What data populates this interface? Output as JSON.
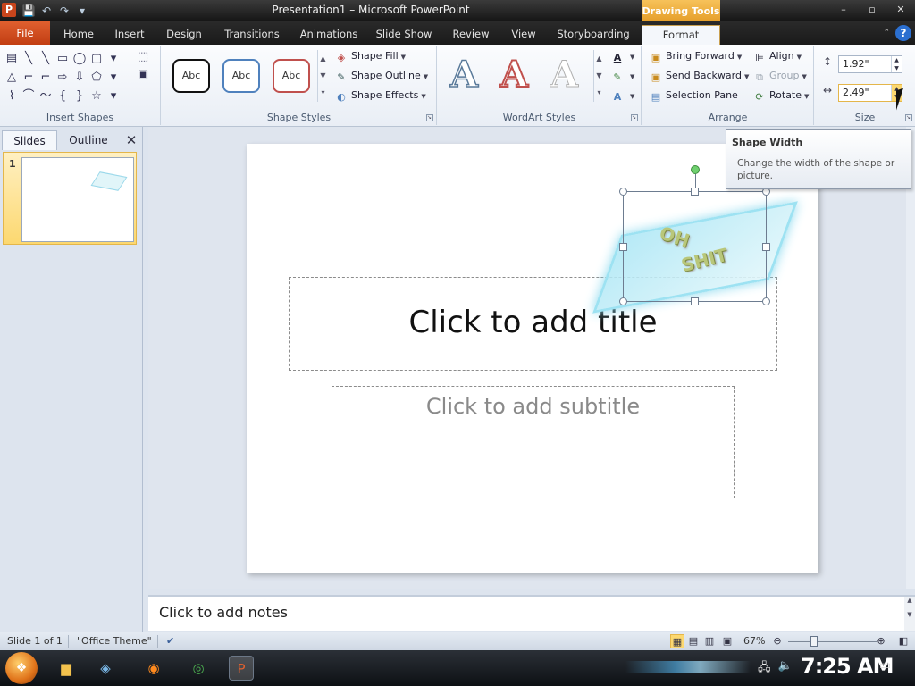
{
  "window": {
    "title": "Presentation1 – Microsoft PowerPoint",
    "app_icon": "P",
    "contextual_group": "Drawing Tools",
    "controls": [
      "–",
      "▫",
      "✕"
    ]
  },
  "qat": {
    "save_icon": "💾",
    "undo_icon": "↶",
    "redo_icon": "↷",
    "more_icon": "▾"
  },
  "tabs": [
    {
      "label": "File"
    },
    {
      "label": "Home"
    },
    {
      "label": "Insert"
    },
    {
      "label": "Design"
    },
    {
      "label": "Transitions"
    },
    {
      "label": "Animations"
    },
    {
      "label": "Slide Show"
    },
    {
      "label": "Review"
    },
    {
      "label": "View"
    },
    {
      "label": "Storyboarding"
    },
    {
      "label": "Format"
    }
  ],
  "ribbon": {
    "insert_shapes": {
      "label": "Insert Shapes",
      "shapes": [
        "▤",
        "╲",
        "╲",
        "▭",
        "◯",
        "▢",
        "▾",
        "△",
        "⌐",
        "⌐",
        "⇨",
        "⇩",
        "⬠",
        "▾",
        "⌇",
        "⌒",
        "〜",
        "{",
        "}",
        "☆",
        "▾"
      ],
      "edit_shape_icon": "⬚",
      "text_box_icon": "▣"
    },
    "shape_styles": {
      "label": "Shape Styles",
      "thumbs": [
        {
          "text": "Abc",
          "border": "#111111"
        },
        {
          "text": "Abc",
          "border": "#4f81bd"
        },
        {
          "text": "Abc",
          "border": "#c0504d"
        }
      ],
      "fill": "Shape Fill",
      "outline": "Shape Outline",
      "effects": "Shape Effects"
    },
    "wordart_styles": {
      "label": "WordArt Styles",
      "letters": [
        {
          "char": "A",
          "style": "outline-blue"
        },
        {
          "char": "A",
          "style": "outline-red"
        },
        {
          "char": "A",
          "style": "outline-gray"
        }
      ]
    },
    "arrange": {
      "label": "Arrange",
      "bring_forward": "Bring Forward",
      "send_backward": "Send Backward",
      "selection_pane": "Selection Pane",
      "align": "Align",
      "group": "Group",
      "rotate": "Rotate"
    },
    "size": {
      "label": "Size",
      "height": "1.92\"",
      "width": "2.49\""
    }
  },
  "slides_pane": {
    "tab_slides": "Slides",
    "tab_outline": "Outline",
    "close": "✕",
    "slide_number": "1"
  },
  "slide": {
    "title_placeholder": "Click to add title",
    "subtitle_placeholder": "Click to add subtitle",
    "wordart_line1": "OH",
    "wordart_line2": "SHIT"
  },
  "tooltip": {
    "title": "Shape Width",
    "body": "Change the width of the shape or picture."
  },
  "notes": {
    "placeholder": "Click to add notes"
  },
  "status": {
    "slide_info": "Slide 1 of 1",
    "theme": "\"Office Theme\"",
    "zoom": "67%"
  },
  "taskbar": {
    "clock": "7:25 AM"
  }
}
